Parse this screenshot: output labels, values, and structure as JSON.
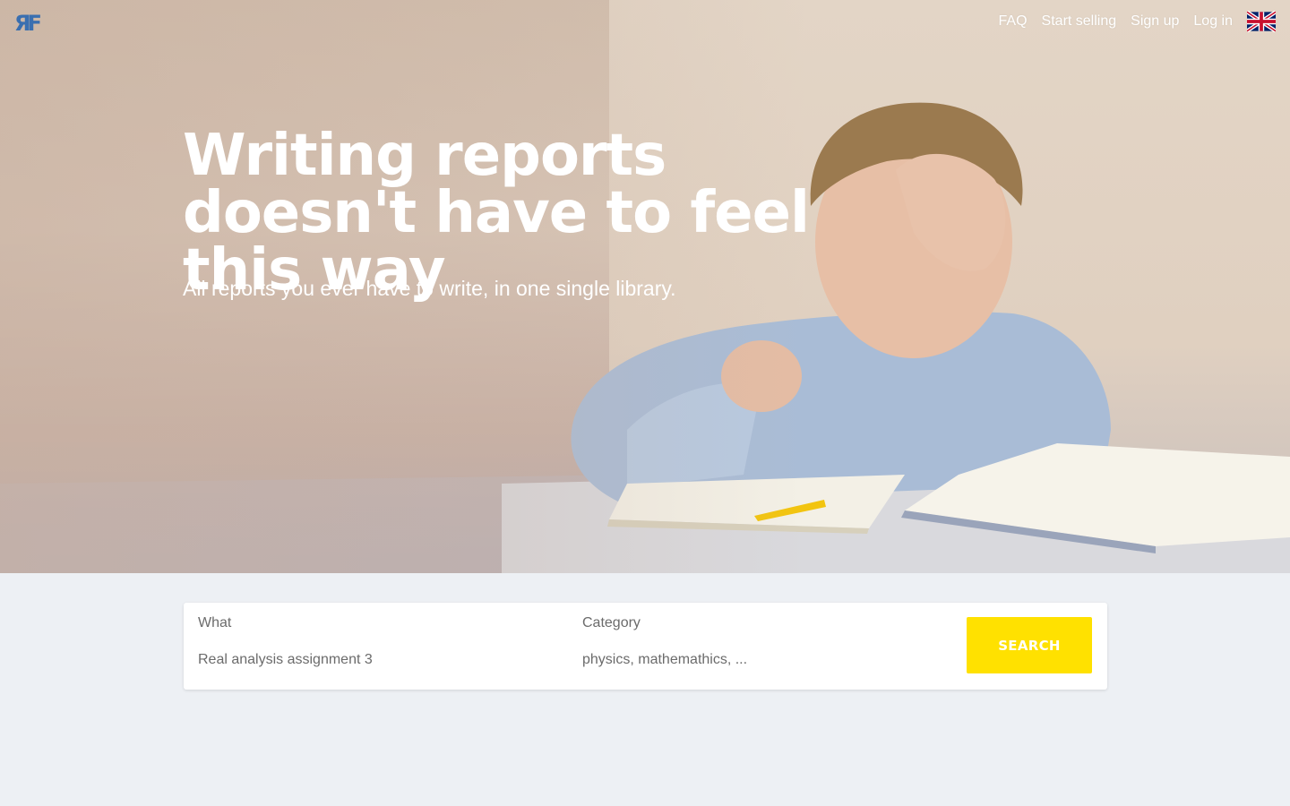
{
  "brand": {
    "logo_text": "ЯF"
  },
  "nav": {
    "items": [
      {
        "label": "FAQ"
      },
      {
        "label": "Start selling"
      },
      {
        "label": "Sign up"
      },
      {
        "label": "Log in"
      }
    ],
    "language_icon": "uk-flag-icon"
  },
  "hero": {
    "title": "Writing reports doesn't have to feel this way",
    "subtitle": "All reports you ever have to write, in one single library."
  },
  "search": {
    "what": {
      "label": "What",
      "placeholder": "Real analysis assignment 3"
    },
    "category": {
      "label": "Category",
      "placeholder": "physics, mathemathics, ..."
    },
    "button_label": "SEARCH"
  },
  "colors": {
    "accent": "#ffe100",
    "page_bg": "#edf0f4",
    "logo_blue": "#3a6fb0"
  }
}
